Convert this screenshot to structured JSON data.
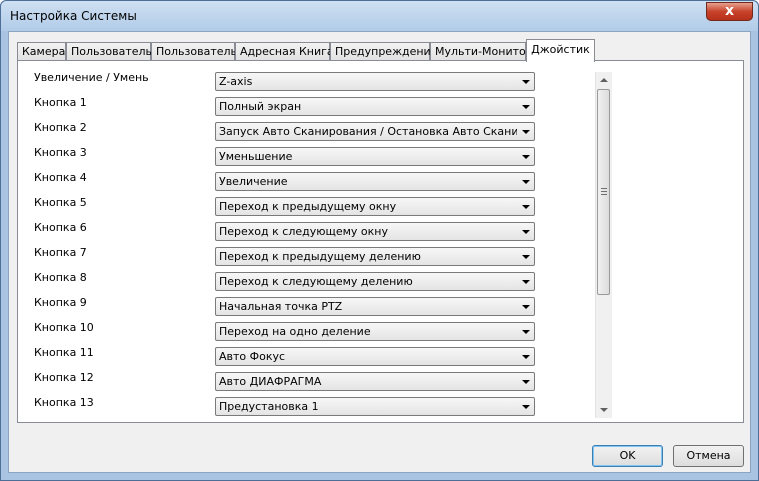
{
  "window": {
    "title": "Настройка Системы",
    "close_glyph": "x"
  },
  "tabs": [
    {
      "label": "Камера"
    },
    {
      "label": "Пользователь"
    },
    {
      "label": "Пользователь"
    },
    {
      "label": "Адресная Книга"
    },
    {
      "label": "Предупреждение"
    },
    {
      "label": "Мульти-Монитор"
    },
    {
      "label": "Джойстик"
    }
  ],
  "active_tab": "Джойстик",
  "rows": [
    {
      "label": "Увеличение / Умень",
      "value": "Z-axis"
    },
    {
      "label": "Кнопка 1",
      "value": "Полный экран"
    },
    {
      "label": "Кнопка 2",
      "value": "Запуск Авто Сканирования / Остановка Авто Сканирован"
    },
    {
      "label": "Кнопка 3",
      "value": "Уменьшение"
    },
    {
      "label": "Кнопка 4",
      "value": "Увеличение"
    },
    {
      "label": "Кнопка 5",
      "value": "Переход к предыдущему окну"
    },
    {
      "label": "Кнопка 6",
      "value": "Переход к следующему окну"
    },
    {
      "label": "Кнопка 7",
      "value": "Переход к предыдущему делению"
    },
    {
      "label": "Кнопка 8",
      "value": "Переход к следующему делению"
    },
    {
      "label": "Кнопка 9",
      "value": "Начальная точка PTZ"
    },
    {
      "label": "Кнопка 10",
      "value": "Переход на одно деление"
    },
    {
      "label": "Кнопка 11",
      "value": "Авто Фокус"
    },
    {
      "label": "Кнопка 12",
      "value": "Авто ДИАФРАГМА"
    },
    {
      "label": "Кнопка 13",
      "value": "Предустановка 1"
    }
  ],
  "buttons": {
    "ok": "OK",
    "cancel": "Отмена"
  }
}
